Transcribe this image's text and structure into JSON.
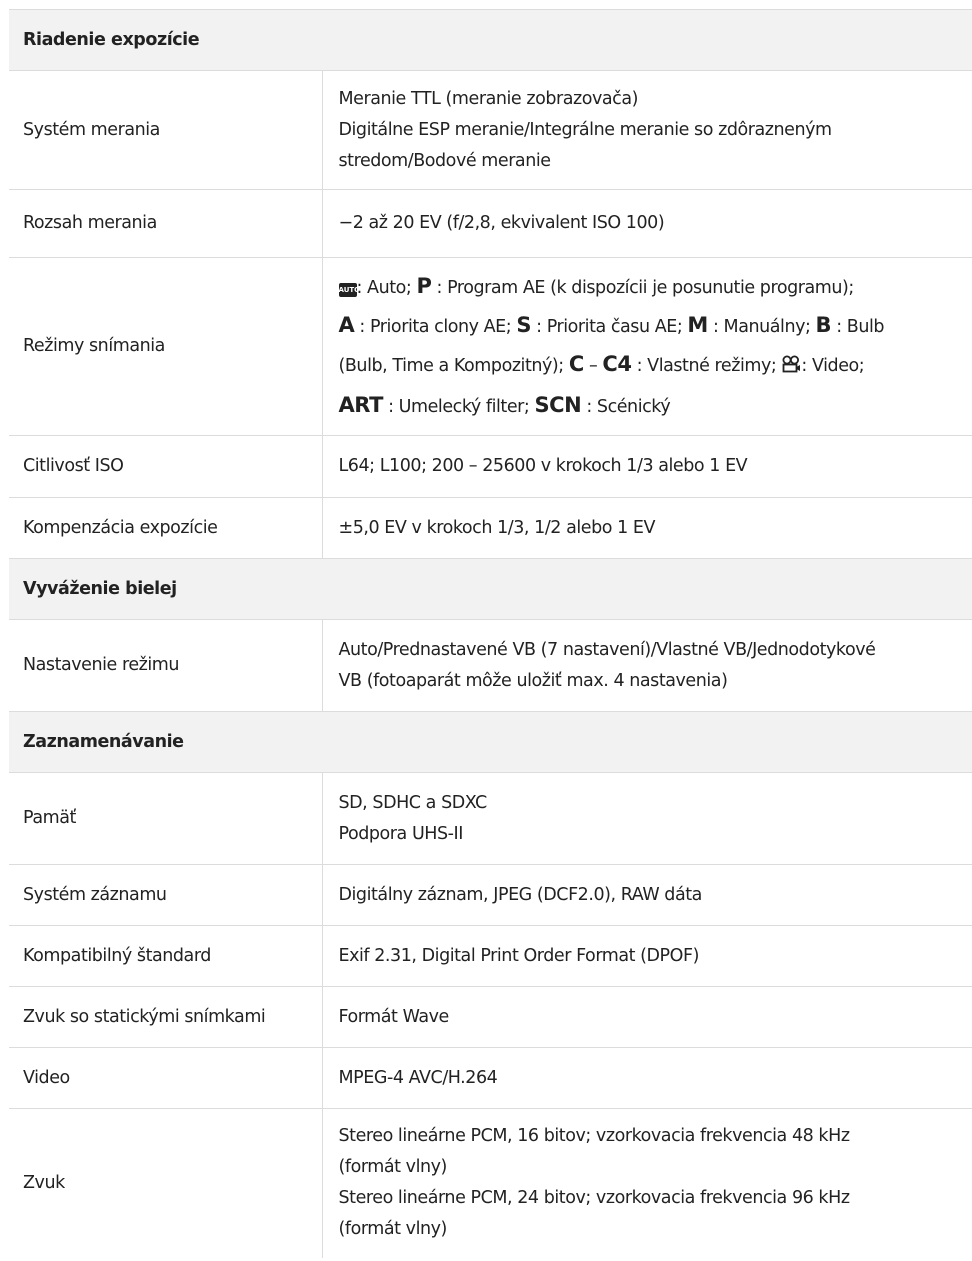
{
  "sections": {
    "exposure": {
      "title": "Riadenie expozície",
      "metering_system": {
        "label": "Systém merania",
        "lines": [
          "Meranie TTL (meranie zobrazovača)",
          "Digitálne ESP meranie/Integrálne meranie so zdôrazneným",
          "stredom/Bodové meranie"
        ]
      },
      "metering_range": {
        "label": "Rozsah merania",
        "value": "−2 až 20 EV (f/2,8, ekvivalent ISO 100)"
      },
      "shooting_modes": {
        "label": "Režimy snímania",
        "icons": {
          "auto": "auto-mode-icon",
          "movie": "movie-mode-icon"
        },
        "auto_icon_text": "AUTO",
        "t1": ": Auto; ",
        "P": "P",
        "t2": " : Program AE (k dispozícii je posunutie programu);",
        "A": "A",
        "t3": " : Priorita clony AE; ",
        "S": "S",
        "t4": " : Priorita času AE; ",
        "M": "M",
        "t5": " : Manuálny; ",
        "B": "B",
        "t6": " : Bulb",
        "t7": "(Bulb, Time a Kompozitný); ",
        "C": "C",
        "dash": " – ",
        "C4": "C4",
        "t8": " : Vlastné režimy; ",
        "t9": ": Video;",
        "ART": "ART",
        "t10": " : Umelecký filter; ",
        "SCN": "SCN",
        "t11": " : Scénický"
      },
      "iso": {
        "label": "Citlivosť ISO",
        "value": "L64; L100; 200 – 25600 v krokoch 1/3 alebo 1 EV"
      },
      "exposure_comp": {
        "label": "Kompenzácia expozície",
        "value": "±5,0 EV v krokoch 1/3, 1/2 alebo 1 EV"
      }
    },
    "white_balance": {
      "title": "Vyváženie bielej",
      "mode": {
        "label": "Nastavenie režimu",
        "lines": [
          "Auto/Prednastavené VB (7 nastavení)/Vlastné VB/Jednodotykové",
          "VB (fotoaparát môže uložiť max. 4 nastavenia)"
        ]
      }
    },
    "recording": {
      "title": "Zaznamenávanie",
      "memory": {
        "label": "Pamäť",
        "lines": [
          "SD, SDHC a SDXC",
          "Podpora UHS-II"
        ]
      },
      "system": {
        "label": "Systém záznamu",
        "value": "Digitálny záznam, JPEG (DCF2.0), RAW dáta"
      },
      "standard": {
        "label": "Kompatibilný štandard",
        "value": "Exif 2.31, Digital Print Order Format (DPOF)"
      },
      "still_sound": {
        "label": "Zvuk so statickými snímkami",
        "value": "Formát Wave"
      },
      "video": {
        "label": "Video",
        "value": "MPEG-4 AVC/H.264"
      },
      "sound": {
        "label": "Zvuk",
        "lines": [
          "Stereo lineárne PCM, 16 bitov; vzorkovacia frekvencia 48 kHz",
          "(formát vlny)",
          "Stereo lineárne PCM, 24 bitov; vzorkovacia frekvencia 96 kHz",
          "(formát vlny)"
        ]
      }
    }
  }
}
